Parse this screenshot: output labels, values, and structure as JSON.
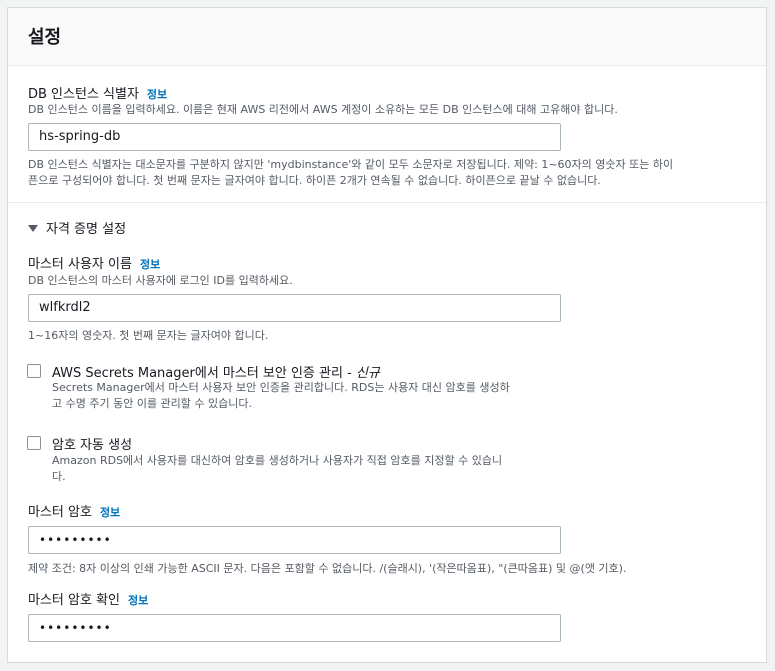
{
  "header": {
    "title": "설정"
  },
  "identifier": {
    "label": "DB 인스턴스 식별자",
    "info": "정보",
    "description": "DB 인스턴스 이름을 입력하세요. 이름은 현재 AWS 리전에서 AWS 계정이 소유하는 모든 DB 인스턴스에 대해 고유해야 합니다.",
    "value": "hs-spring-db",
    "constraint_line1": "DB 인스턴스 식별자는 대소문자를 구분하지 않지만 'mydbinstance'와 같이 모두 소문자로 저장됩니다. 제약: 1~60자의 영숫자 또는 하이",
    "constraint_line2": "픈으로 구성되어야 합니다. 첫 번째 문자는 글자여야 합니다. 하이픈 2개가 연속될 수 없습니다. 하이픈으로 끝날 수 없습니다."
  },
  "credentials": {
    "section_title": "자격 증명 설정",
    "expanded": true,
    "master_username": {
      "label": "마스터 사용자 이름",
      "info": "정보",
      "description": "DB 인스턴스의 마스터 사용자에 로그인 ID를 입력하세요.",
      "value": "wlfkrdl2",
      "constraint": "1~16자의 영숫자. 첫 번째 문자는 글자여야 합니다."
    },
    "secrets_manager": {
      "label": "AWS Secrets Manager에서 마스터 보안 인증 관리 - ",
      "new_tag": "신규",
      "description_line1": "Secrets Manager에서 마스터 사용자 보안 인증을 관리합니다. RDS는 사용자 대신 암호를 생성하",
      "description_line2": "고 수명 주기 동안 이를 관리할 수 있습니다.",
      "checked": false
    },
    "auto_password": {
      "label": "암호 자동 생성",
      "description_line1": "Amazon RDS에서 사용자를 대신하여 암호를 생성하거나 사용자가 직접 암호를 지정할 수 있습니",
      "description_line2": "다.",
      "checked": false
    },
    "master_password": {
      "label": "마스터 암호",
      "info": "정보",
      "value": "•••••••••",
      "constraint": "제약 조건: 8자 이상의 인쇄 가능한 ASCII 문자. 다음은 포함할 수 없습니다. /(슬래시), '(작은따옴표), \"(큰따옴표) 및 @(앳 기호)."
    },
    "confirm_password": {
      "label": "마스터 암호 확인",
      "info": "정보",
      "value": "•••••••••"
    }
  }
}
